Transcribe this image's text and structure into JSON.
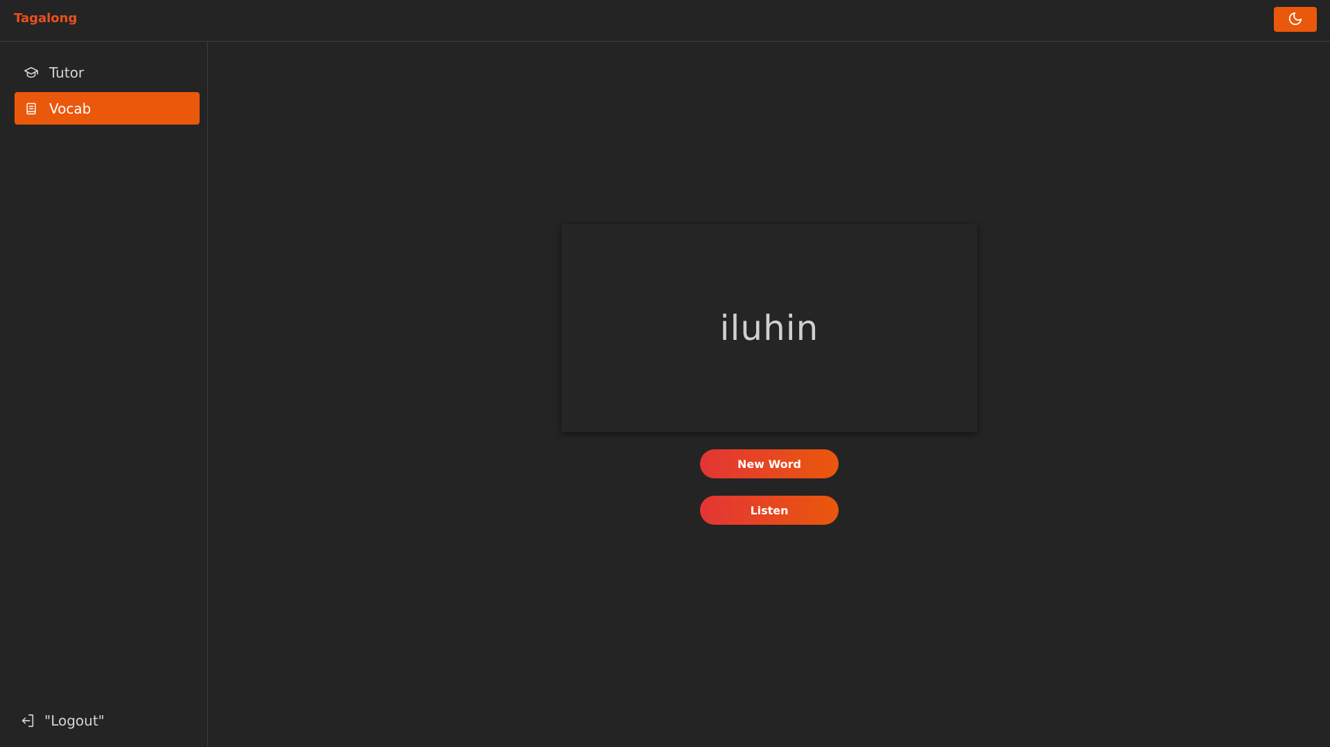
{
  "header": {
    "brand": "Tagalong",
    "theme_toggle_icon": "moon-icon"
  },
  "sidebar": {
    "items": [
      {
        "label": "Tutor",
        "icon": "graduation-cap-icon",
        "active": false
      },
      {
        "label": "Vocab",
        "icon": "book-icon",
        "active": true
      }
    ],
    "logout": {
      "label": "\"Logout\"",
      "icon": "log-in-icon"
    }
  },
  "main": {
    "word": "iluhin",
    "new_word_label": "New Word",
    "listen_label": "Listen"
  },
  "colors": {
    "accent": "#ea580c",
    "brand": "#e8501e",
    "gradient_start": "#e33535",
    "background": "#242424"
  }
}
